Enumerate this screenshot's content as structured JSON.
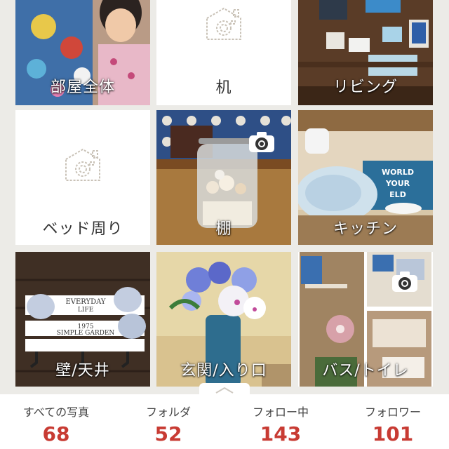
{
  "folders": [
    {
      "label": "部屋全体",
      "has_photo": true
    },
    {
      "label": "机",
      "has_photo": false
    },
    {
      "label": "リビング",
      "has_photo": true
    },
    {
      "label": "ベッド周り",
      "has_photo": false
    },
    {
      "label": "棚",
      "has_photo": true
    },
    {
      "label": "キッチン",
      "has_photo": true
    },
    {
      "label": "壁/天井",
      "has_photo": true
    },
    {
      "label": "玄関/入り口",
      "has_photo": true
    },
    {
      "label": "バス/トイレ",
      "has_photo": true
    }
  ],
  "stats": [
    {
      "label": "すべての写真",
      "count": "68"
    },
    {
      "label": "フォルダ",
      "count": "52"
    },
    {
      "label": "フォロー中",
      "count": "143"
    },
    {
      "label": "フォロワー",
      "count": "101"
    }
  ],
  "sign_text": {
    "everyday": "EVERYDAY",
    "life": "LIFE",
    "year": "1975",
    "garden": "SIMPLE GARDEN",
    "world": "WORLD",
    "your": "YOUR",
    "eld": "ELD"
  },
  "colors": {
    "count": "#c83b33",
    "background": "#ecebe7",
    "tile_empty": "#ffffff"
  },
  "icons": {
    "placeholder": "camera-house-icon",
    "add_photo": "camera-icon",
    "drawer": "chevron-up-icon"
  }
}
